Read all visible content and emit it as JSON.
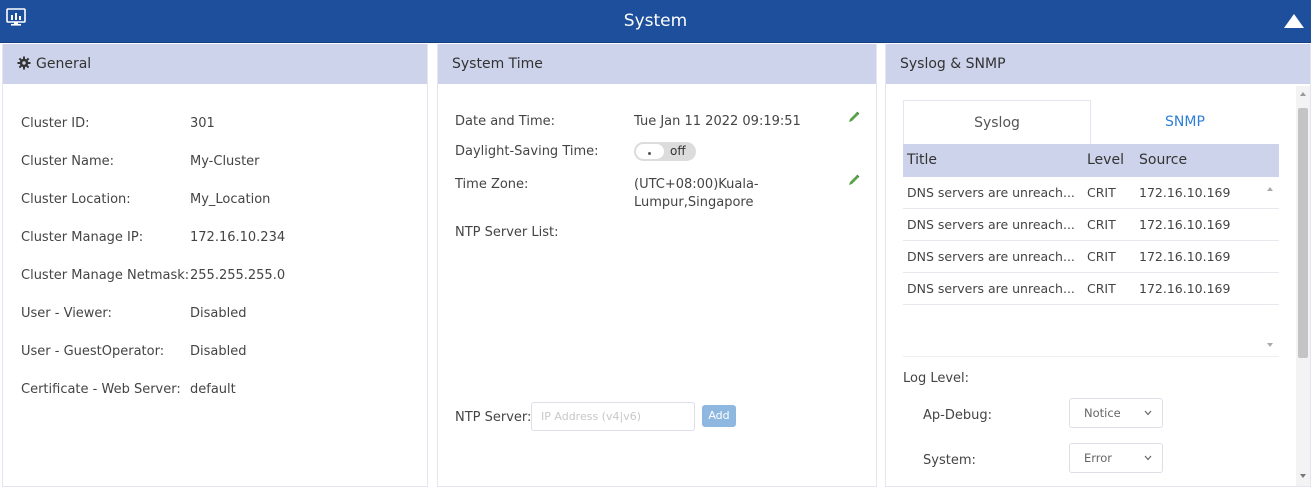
{
  "header": {
    "title": "System",
    "monitor_icon": "monitor-icon",
    "collapse_icon": "collapse-up-icon",
    "color": "#1d4f9c"
  },
  "general": {
    "title": "General",
    "rows": [
      {
        "label": "Cluster ID:",
        "value": "301"
      },
      {
        "label": "Cluster Name:",
        "value": "My-Cluster"
      },
      {
        "label": "Cluster Location:",
        "value": "My_Location"
      },
      {
        "label": "Cluster Manage IP:",
        "value": "172.16.10.234"
      },
      {
        "label": "Cluster Manage Netmask:",
        "value": "255.255.255.0"
      },
      {
        "label": "User - Viewer:",
        "value": "Disabled"
      },
      {
        "label": "User - GuestOperator:",
        "value": "Disabled"
      },
      {
        "label": "Certificate - Web Server:",
        "value": "default"
      }
    ]
  },
  "system_time": {
    "title": "System Time",
    "date_label": "Date and Time:",
    "date_value": "Tue Jan 11 2022 09:19:51",
    "dst_label": "Daylight-Saving Time:",
    "dst_value": "off",
    "tz_label": "Time Zone:",
    "tz_value_line1": "(UTC+08:00)Kuala-",
    "tz_value_line2": "Lumpur,Singapore",
    "ntp_list_label": "NTP Server List:",
    "ntp_server_label": "NTP Server:",
    "ntp_placeholder": "IP Address (v4|v6)",
    "add_label": "Add"
  },
  "syslog": {
    "title": "Syslog & SNMP",
    "tabs": [
      "Syslog",
      "SNMP"
    ],
    "columns": [
      "Title",
      "Level",
      "Source"
    ],
    "rows": [
      {
        "title": "DNS servers are unreach...",
        "level": "CRIT",
        "source": "172.16.10.169"
      },
      {
        "title": "DNS servers are unreach...",
        "level": "CRIT",
        "source": "172.16.10.169"
      },
      {
        "title": "DNS servers are unreach...",
        "level": "CRIT",
        "source": "172.16.10.169"
      },
      {
        "title": "DNS servers are unreach...",
        "level": "CRIT",
        "source": "172.16.10.169"
      }
    ],
    "log_level_label": "Log Level:",
    "levels": [
      {
        "label": "Ap-Debug:",
        "value": "Notice"
      },
      {
        "label": "System:",
        "value": "Error"
      }
    ]
  }
}
